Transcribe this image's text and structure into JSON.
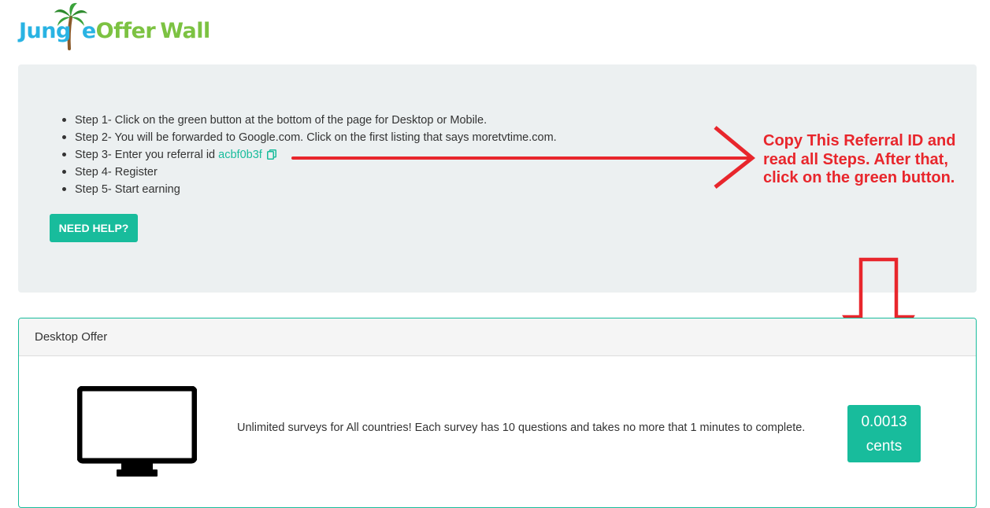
{
  "logo": {
    "part1": "Jung",
    "part2": "e",
    "part3": "Offer",
    "part4": "Wall",
    "palm_icon": "palm-tree-icon"
  },
  "steps": {
    "items": [
      "Step 1- Click on the green button at the bottom of the page for Desktop or Mobile.",
      "Step 2- You will be forwarded to Google.com. Click on the first listing that says moretvtime.com.",
      "Step 3- Enter you referral id",
      "Step 4- Register",
      "Step 5- Start earning"
    ],
    "referral_id": "acbf0b3f",
    "copy_icon": "copy-icon",
    "help_button": "NEED HELP?"
  },
  "annotation": {
    "text": "Copy This Referral ID and read all Steps. After that, click on the green button.",
    "color": "#e8262c"
  },
  "desktop_offer": {
    "title": "Desktop Offer",
    "monitor_icon": "monitor-icon",
    "description": "Unlimited surveys for All countries! Each survey has 10 questions and takes no more that 1 minutes to complete.",
    "reward_value": "0.0013",
    "reward_unit": "cents"
  },
  "colors": {
    "accent": "#18bc9c",
    "panel_bg": "#ecf0f1",
    "logo_blue": "#29b3e3",
    "logo_green": "#7cc242"
  }
}
